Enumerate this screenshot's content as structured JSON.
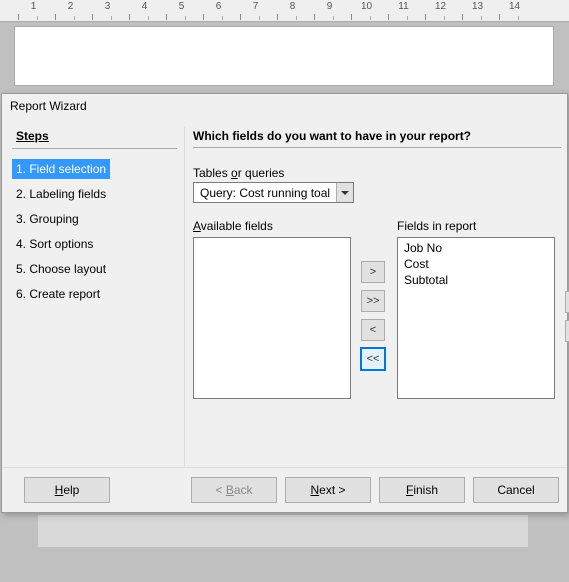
{
  "ruler": {
    "labels": [
      "1",
      "2",
      "3",
      "4",
      "5",
      "6",
      "7",
      "8",
      "9",
      "10",
      "11",
      "12",
      "13",
      "14"
    ]
  },
  "dialog": {
    "title": "Report Wizard",
    "steps_heading": "Steps",
    "steps": [
      {
        "label": "1. Field selection",
        "selected": true
      },
      {
        "label": "2. Labeling fields",
        "selected": false
      },
      {
        "label": "3. Grouping",
        "selected": false
      },
      {
        "label": "4. Sort options",
        "selected": false
      },
      {
        "label": "5. Choose layout",
        "selected": false
      },
      {
        "label": "6. Create report",
        "selected": false
      }
    ],
    "main_heading": "Which fields do you want to have in your report?",
    "tables_queries_label": "Tables or queries",
    "tables_queries_value": "Query: Cost running toal",
    "available_label": "Available fields",
    "available_fields": [],
    "report_label": "Fields in report",
    "report_fields": [
      "Job No",
      "Cost",
      "Subtotal"
    ],
    "move_buttons": {
      "add": ">",
      "add_all": ">>",
      "remove": "<",
      "remove_all": "<<"
    },
    "buttons": {
      "help": "Help",
      "back": "< Back",
      "next": "Next >",
      "finish": "Finish",
      "cancel": "Cancel"
    }
  }
}
